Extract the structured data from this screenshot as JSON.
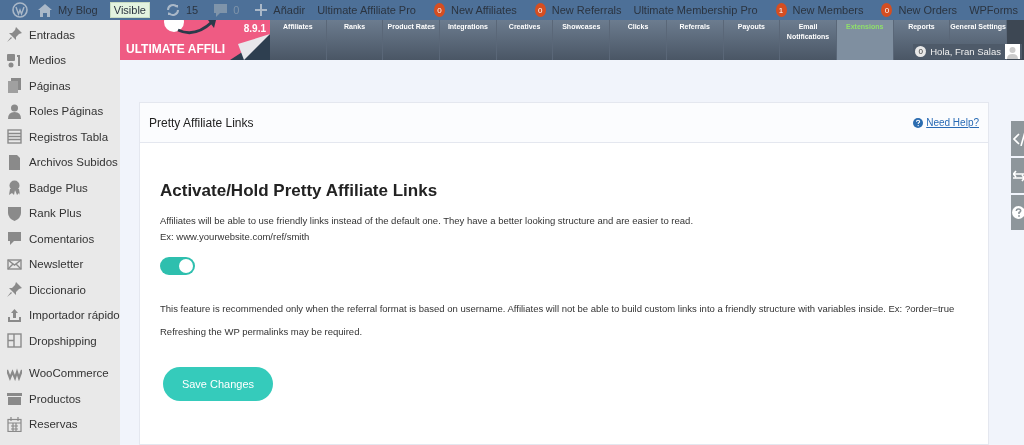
{
  "admin_bar": {
    "site": "My Blog",
    "visibility": "Visible",
    "updates": "15",
    "comments": "0",
    "add": "Añadir",
    "items": [
      {
        "label": "Ultimate Affiliate Pro"
      },
      {
        "count": "0",
        "label": "New Affiliates"
      },
      {
        "count": "0",
        "label": "New Referrals"
      },
      {
        "label": "Ultimate Membership Pro"
      },
      {
        "count": "1",
        "label": "New Members"
      },
      {
        "count": "0",
        "label": "New Orders"
      },
      {
        "label": "WPForms"
      }
    ]
  },
  "sidebar": {
    "items": [
      {
        "label": "Entradas",
        "kind": "pin"
      },
      {
        "label": "Medios",
        "kind": "media"
      },
      {
        "label": "Páginas",
        "kind": "pages"
      },
      {
        "label": "Roles Páginas",
        "kind": "user"
      },
      {
        "label": "Registros Tabla",
        "kind": "table"
      },
      {
        "label": "Archivos Subidos",
        "kind": "file"
      },
      {
        "label": "Badge Plus",
        "kind": "badge"
      },
      {
        "label": "Rank Plus",
        "kind": "shield"
      },
      {
        "label": "Comentarios",
        "kind": "comment"
      },
      {
        "label": "Newsletter",
        "kind": "mail"
      },
      {
        "label": "Diccionario",
        "kind": "pin"
      },
      {
        "label": "Importador rápido",
        "kind": "upload"
      },
      {
        "label": "Dropshipping",
        "kind": "layout"
      },
      {
        "label": "WooCommerce",
        "kind": "woo"
      },
      {
        "label": "Productos",
        "kind": "box"
      },
      {
        "label": "Reservas",
        "kind": "calendar"
      }
    ]
  },
  "plugin_header": {
    "version": "8.9.1",
    "logo_text": "ULTIMATE AFFILI",
    "tabs": [
      {
        "label": "Affiliates",
        "selected": false
      },
      {
        "label": "Ranks",
        "selected": false
      },
      {
        "label": "Product Rates",
        "selected": false
      },
      {
        "label": "Integrations",
        "selected": false
      },
      {
        "label": "Creatives",
        "selected": false
      },
      {
        "label": "Showcases",
        "selected": false
      },
      {
        "label": "Clicks",
        "selected": false
      },
      {
        "label": "Referrals",
        "selected": false
      },
      {
        "label": "Payouts",
        "selected": false
      },
      {
        "label": "Email Notifications",
        "selected": false
      },
      {
        "label": "Extensions",
        "selected": true
      },
      {
        "label": "Reports",
        "selected": false
      },
      {
        "label": "General Settings",
        "selected": false
      }
    ],
    "user": {
      "count": "0",
      "greeting": "Hola, Fran Salas"
    }
  },
  "card": {
    "title": "Pretty Affiliate Links",
    "help": "Need Help?",
    "heading": "Activate/Hold Pretty Affiliate Links",
    "description": "Affiliates will be able to use friendly links instead of the default one. They have a better looking structure and are easier to read. Ex: www.yourwebsite.com/ref/smith",
    "toggle": {
      "on": true
    },
    "notes": [
      "This feature is recommended only when the referral format is based on username. Affiliates will not be able to build custom links into a friendly structure with variables inside. Ex: ?order=true",
      "Refreshing the WP permalinks may be required."
    ],
    "save": "Save Changes"
  },
  "side_tabs": [
    {
      "kind": "code"
    },
    {
      "kind": "swap"
    },
    {
      "kind": "help"
    }
  ]
}
